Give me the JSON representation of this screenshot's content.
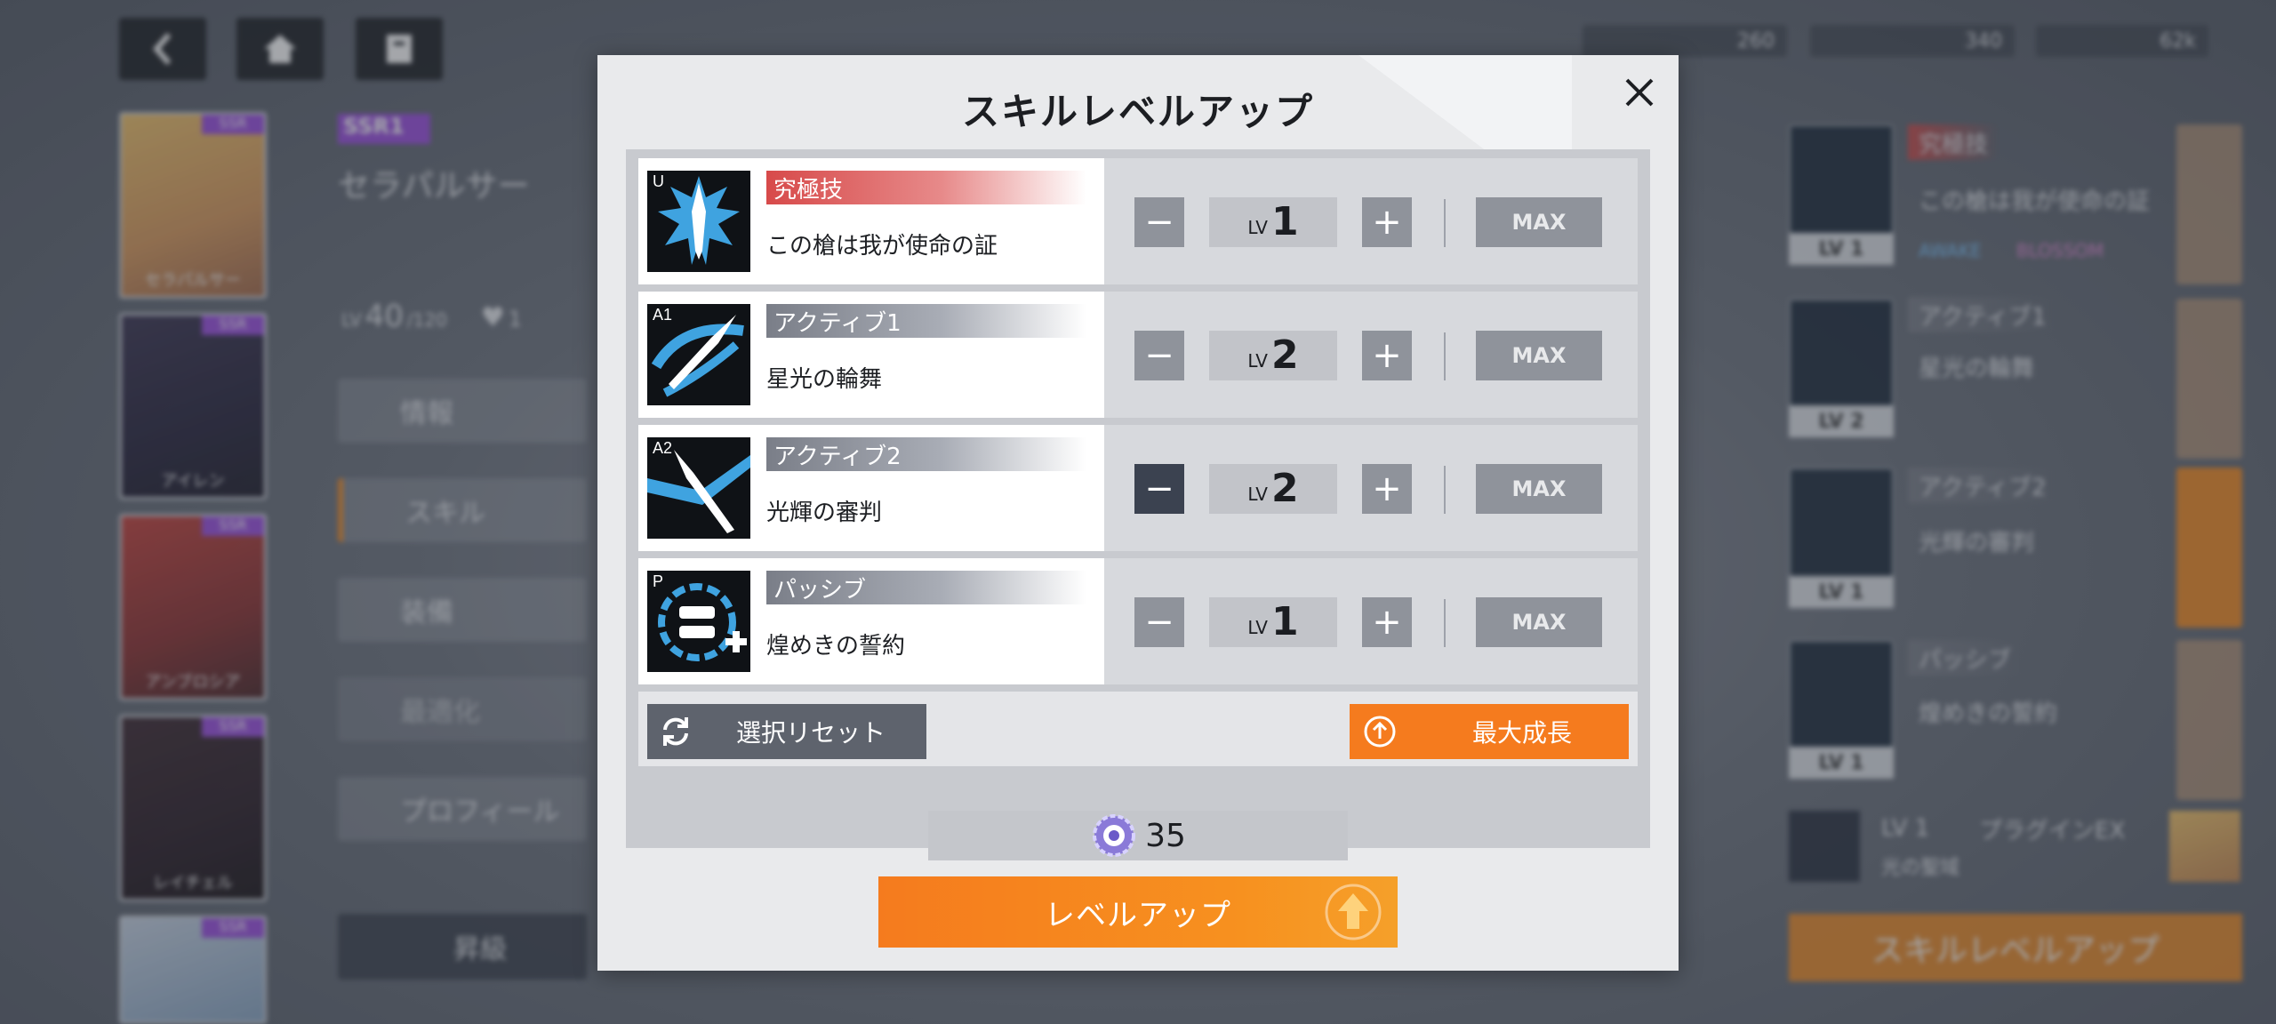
{
  "modal": {
    "title": "スキルレベルアップ",
    "skills": [
      {
        "tag": "U",
        "type": "究極技",
        "name": "この槍は我が使命の証",
        "lv_prefix": "LV",
        "level": "1",
        "max_label": "MAX",
        "accent": "ult"
      },
      {
        "tag": "A1",
        "type": "アクティブ1",
        "name": "星光の輪舞",
        "lv_prefix": "LV",
        "level": "2",
        "max_label": "MAX",
        "accent": "norm"
      },
      {
        "tag": "A2",
        "type": "アクティブ2",
        "name": "光輝の審判",
        "lv_prefix": "LV",
        "level": "2",
        "max_label": "MAX",
        "accent": "norm"
      },
      {
        "tag": "P",
        "type": "パッシブ",
        "name": "煌めきの誓約",
        "lv_prefix": "LV",
        "level": "1",
        "max_label": "MAX",
        "accent": "norm"
      }
    ],
    "reset_label": "選択リセット",
    "max_growth_label": "最大成長",
    "cost": "35",
    "levelup_label": "レベルアップ"
  },
  "background": {
    "character": {
      "rarity": "SSR1",
      "name": "セラパルサー",
      "lv_prefix": "LV",
      "level": "40",
      "level_max": "/120",
      "likes": "1"
    },
    "currencies": [
      "260",
      "340",
      "62k"
    ],
    "roster": [
      {
        "rarity": "SSR",
        "name": "セラパルサー"
      },
      {
        "rarity": "SSR",
        "name": "アイレン"
      },
      {
        "rarity": "SSR",
        "name": "アンブロシア"
      },
      {
        "rarity": "SSR",
        "name": "レイチェル"
      },
      {
        "rarity": "SSR",
        "name": ""
      }
    ],
    "menu": [
      {
        "label": "情報"
      },
      {
        "label": "スキル"
      },
      {
        "label": "装備"
      },
      {
        "label": "最適化"
      },
      {
        "label": "プロフィール"
      }
    ],
    "ascend_label": "昇級",
    "right_panel": [
      {
        "type": "究極技",
        "name": "この槍は我が使命の証",
        "lv": "LV 1"
      },
      {
        "type": "アクティブ1",
        "name": "星光の輪舞",
        "lv": "LV 2"
      },
      {
        "type": "アクティブ2",
        "name": "光輝の審判",
        "lv": "LV 1"
      },
      {
        "type": "パッシブ",
        "name": "煌めきの誓約",
        "lv": "LV 1"
      }
    ],
    "plugin": {
      "lv": "LV 1",
      "label": "プラグインEX",
      "sub": "光の聖域"
    },
    "skill_levelup_label": "スキルレベルアップ",
    "awake_tag": "AWAKE",
    "blossom_tag": "BLOSSOM"
  },
  "colors": {
    "accent_orange": "#f57b1e",
    "ultimate_red": "#d74a4a",
    "rarity_purple": "#9b4de0"
  }
}
